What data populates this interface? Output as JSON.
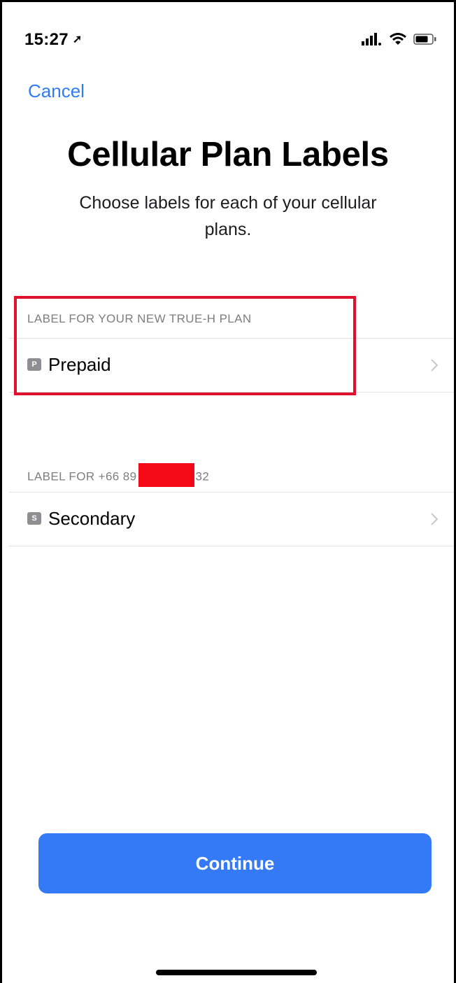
{
  "status_bar": {
    "time": "15:27",
    "icons": [
      "location-arrow-icon",
      "cellular-signal-icon",
      "wifi-icon",
      "battery-icon"
    ]
  },
  "nav": {
    "cancel_label": "Cancel"
  },
  "header": {
    "title": "Cellular Plan Labels",
    "subtitle": "Choose labels for each of your cellular plans."
  },
  "sections": [
    {
      "header": "LABEL FOR YOUR NEW TRUE-H PLAN",
      "badge": "P",
      "label": "Prepaid",
      "highlighted": true
    },
    {
      "header_prefix": "LABEL FOR +66 89",
      "header_suffix": "32",
      "redacted": true,
      "badge": "S",
      "label": "Secondary"
    }
  ],
  "footer": {
    "continue_label": "Continue"
  },
  "colors": {
    "accent": "#2f7cf6",
    "button": "#3479f6",
    "highlight": "#e0112c",
    "redaction": "#f20a16",
    "secondary_text": "#7d7d82"
  }
}
